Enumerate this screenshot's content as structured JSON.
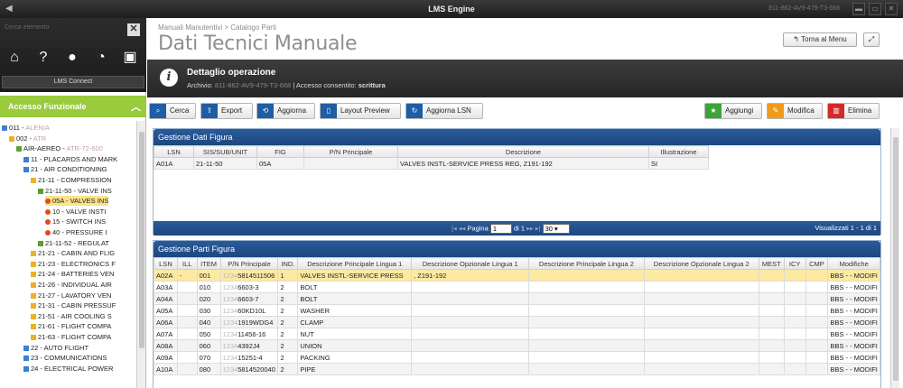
{
  "titlebar": {
    "title": "LMS Engine",
    "serial": "811-862-AV9-479-T3-668"
  },
  "sidebar": {
    "search_placeholder": "Cerca elemento",
    "connect_label": "LMS Connect",
    "accesso_label": "Accesso Funzionale",
    "tree": [
      {
        "label": "011 - ",
        "blur": "ALENIA",
        "indent": 0,
        "color": "#3b7fd0"
      },
      {
        "label": "002 - ",
        "blur": "ATR",
        "indent": 1,
        "color": "#f0b020"
      },
      {
        "label": "AIR-AEREO - ",
        "blur": "ATR-72-600",
        "indent": 2,
        "color": "#5aa02c"
      },
      {
        "label": "11 - PLACARDS AND MARK",
        "blur": "",
        "indent": 3,
        "color": "#3b7fd0"
      },
      {
        "label": "21 - AIR CONDITIONING",
        "blur": "",
        "indent": 3,
        "color": "#3b7fd0"
      },
      {
        "label": "21-11 - COMPRESSION",
        "blur": "",
        "indent": 4,
        "color": "#f0b020"
      },
      {
        "label": "21-11-50 - VALVE INS",
        "blur": "",
        "indent": 5,
        "color": "#5aa02c"
      },
      {
        "label": "05A - VALVES INS",
        "blur": "",
        "indent": 6,
        "color": "#e04a1a",
        "selected": true
      },
      {
        "label": "10 - VALVE INSTI",
        "blur": "",
        "indent": 6,
        "color": "#e04a1a"
      },
      {
        "label": "15 - SWITCH INS",
        "blur": "",
        "indent": 6,
        "color": "#e04a1a"
      },
      {
        "label": "40 - PRESSURE I",
        "blur": "",
        "indent": 6,
        "color": "#e04a1a"
      },
      {
        "label": "21-11-52 - REGULAT",
        "blur": "",
        "indent": 5,
        "color": "#5aa02c"
      },
      {
        "label": "21-21 - CABIN AND FLIG",
        "blur": "",
        "indent": 4,
        "color": "#f0b020"
      },
      {
        "label": "21-23 - ELECTRONICS F",
        "blur": "",
        "indent": 4,
        "color": "#f0b020"
      },
      {
        "label": "21-24 - BATTERIES VEN",
        "blur": "",
        "indent": 4,
        "color": "#f0b020"
      },
      {
        "label": "21-26 - INDIVIDUAL AIR",
        "blur": "",
        "indent": 4,
        "color": "#f0b020"
      },
      {
        "label": "21-27 - LAVATORY VEN",
        "blur": "",
        "indent": 4,
        "color": "#f0b020"
      },
      {
        "label": "21-31 - CABIN PRESSUF",
        "blur": "",
        "indent": 4,
        "color": "#f0b020"
      },
      {
        "label": "21-51 - AIR COOLING S",
        "blur": "",
        "indent": 4,
        "color": "#f0b020"
      },
      {
        "label": "21-61 - FLIGHT COMPA",
        "blur": "",
        "indent": 4,
        "color": "#f0b020"
      },
      {
        "label": "21-63 - FLIGHT COMPA",
        "blur": "",
        "indent": 4,
        "color": "#f0b020"
      },
      {
        "label": "22 - AUTO FLIGHT",
        "blur": "",
        "indent": 3,
        "color": "#3b7fd0"
      },
      {
        "label": "23 - COMMUNICATIONS",
        "blur": "",
        "indent": 3,
        "color": "#3b7fd0"
      },
      {
        "label": "24 - ELECTRICAL POWER",
        "blur": "",
        "indent": 3,
        "color": "#3b7fd0"
      }
    ]
  },
  "header": {
    "breadcrumb": "Manuali Manutentivi > Catalogo Parti",
    "title": "Dati Tecnici Manuale",
    "back_label": "Torna al Menu",
    "expand_icon": "⤢"
  },
  "operation": {
    "title": "Dettaglio operazione",
    "archive_label": "Archivio:",
    "archive_value": "811-862-AV9-479-T3-668",
    "access_label": "| Accesso consentito:",
    "access_value": "scrittura"
  },
  "toolbar": {
    "cerca": "Cerca",
    "export": "Export",
    "aggiorna": "Aggiorna",
    "layout_preview": "Layout Preview",
    "aggiorna_lsn": "Aggiorna LSN",
    "aggiungi": "Aggiungi",
    "modifica": "Modifica",
    "elimina": "Elimina"
  },
  "figura": {
    "title": "Gestione Dati Figura",
    "columns": [
      "LSN",
      "SIS/SUB/UNIT",
      "FIG",
      "P/N Principale",
      "Descrizione",
      "Illustrazione"
    ],
    "row": [
      "A01A",
      "21-11-50",
      "05A",
      "",
      "VALVES INSTL-SERVICE PRESS REG, Z191-192",
      "SI"
    ],
    "pager": {
      "page_label": "Pagina",
      "page_value": "1",
      "of_label": "di 1",
      "per_page": "30",
      "summary": "Visualizzati 1 - 1 di 1"
    }
  },
  "parti": {
    "title": "Gestione Parti Figura",
    "columns": [
      "LSN",
      "ILL",
      "ITEM",
      "P/N Principale",
      "IND.",
      "Descrizione Principale Lingua 1",
      "Descrizione Opzionale Lingua 1",
      "Descrizione Principale Lingua 2",
      "Descrizione Opzionale Lingua 2",
      "MEST",
      "ICY",
      "CMP",
      "Modifiche"
    ],
    "rows": [
      {
        "lsn": "A02A",
        "ill": "-",
        "item": "001",
        "pn_blur": "1234",
        "pn": "5814511506",
        "ind": "1",
        "d1": "VALVES INSTL-SERVICE PRESS",
        "o1": ", Z191-192",
        "mod": "BBS - - MODIFI",
        "sel": true
      },
      {
        "lsn": "A03A",
        "ill": "",
        "item": "010",
        "pn_blur": "1234",
        "pn": "6603-3",
        "ind": "2",
        "d1": "BOLT",
        "o1": "",
        "mod": "BBS - - MODIFI"
      },
      {
        "lsn": "A04A",
        "ill": "",
        "item": "020",
        "pn_blur": "1234",
        "pn": "6603-7",
        "ind": "2",
        "d1": "BOLT",
        "o1": "",
        "mod": "BBS - - MODIFI"
      },
      {
        "lsn": "A05A",
        "ill": "",
        "item": "030",
        "pn_blur": "1234",
        "pn": "60KD10L",
        "ind": "2",
        "d1": "WASHER",
        "o1": "",
        "mod": "BBS - - MODIFI"
      },
      {
        "lsn": "A06A",
        "ill": "",
        "item": "040",
        "pn_blur": "1234",
        "pn": "1919WDG4",
        "ind": "2",
        "d1": "CLAMP",
        "o1": "",
        "mod": "BBS - - MODIFI"
      },
      {
        "lsn": "A07A",
        "ill": "",
        "item": "050",
        "pn_blur": "1234",
        "pn": "11456-16",
        "ind": "2",
        "d1": "NUT",
        "o1": "",
        "mod": "BBS - - MODIFI"
      },
      {
        "lsn": "A08A",
        "ill": "",
        "item": "060",
        "pn_blur": "1234",
        "pn": "4392J4",
        "ind": "2",
        "d1": "UNION",
        "o1": "",
        "mod": "BBS - - MODIFI"
      },
      {
        "lsn": "A09A",
        "ill": "",
        "item": "070",
        "pn_blur": "1234",
        "pn": "15251-4",
        "ind": "2",
        "d1": "PACKING",
        "o1": "",
        "mod": "BBS - - MODIFI"
      },
      {
        "lsn": "A10A",
        "ill": "",
        "item": "080",
        "pn_blur": "1234",
        "pn": "5814520040",
        "ind": "2",
        "d1": "PIPE",
        "o1": "",
        "mod": "BBS - - MODIFI"
      }
    ]
  },
  "colors": {
    "accent_green": "#9acb3c",
    "panel_blue": "#1d4780",
    "selected_row": "#fde9a2"
  }
}
